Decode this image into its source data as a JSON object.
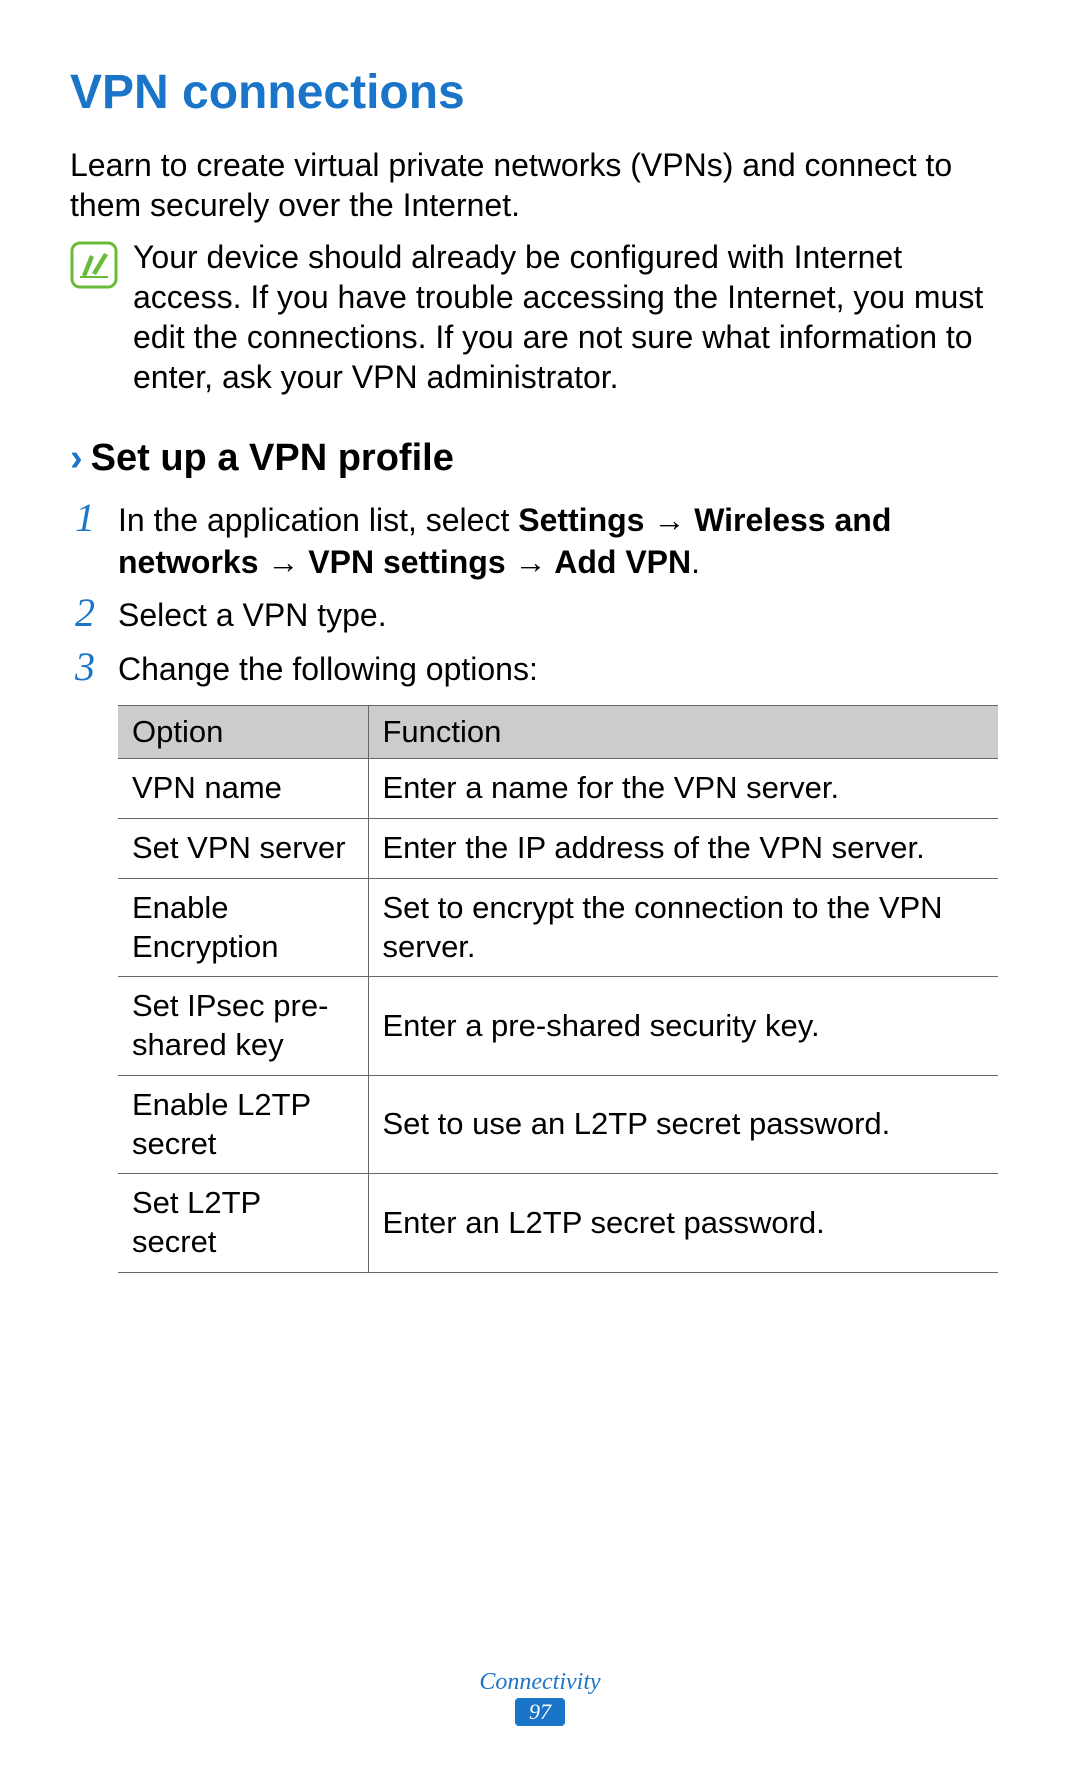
{
  "heading": "VPN connections",
  "intro": "Learn to create virtual private networks (VPNs) and connect to them securely over the Internet.",
  "note": "Your device should already be configured with Internet access. If you have trouble accessing the Internet, you must edit the connections. If you are not sure what information to enter, ask your VPN administrator.",
  "sub_heading": "Set up a VPN profile",
  "steps": {
    "s1_prefix": "In the application list, select ",
    "s1_bold": "Settings → Wireless and networks → VPN settings → Add VPN",
    "s1_suffix": ".",
    "s2": "Select a VPN type.",
    "s3": "Change the following options:"
  },
  "table": {
    "header_option": "Option",
    "header_function": "Function",
    "rows": [
      {
        "option": "VPN name",
        "function": "Enter a name for the VPN server."
      },
      {
        "option": "Set VPN server",
        "function": "Enter the IP address of the VPN server."
      },
      {
        "option": "Enable Encryption",
        "function": "Set to encrypt the connection to the VPN server."
      },
      {
        "option": "Set IPsec pre-shared key",
        "function": "Enter a pre-shared security key."
      },
      {
        "option": "Enable L2TP secret",
        "function": "Set to use an L2TP secret password."
      },
      {
        "option": "Set L2TP secret",
        "function": "Enter an L2TP secret password."
      }
    ]
  },
  "footer": {
    "section": "Connectivity",
    "page": "97"
  }
}
